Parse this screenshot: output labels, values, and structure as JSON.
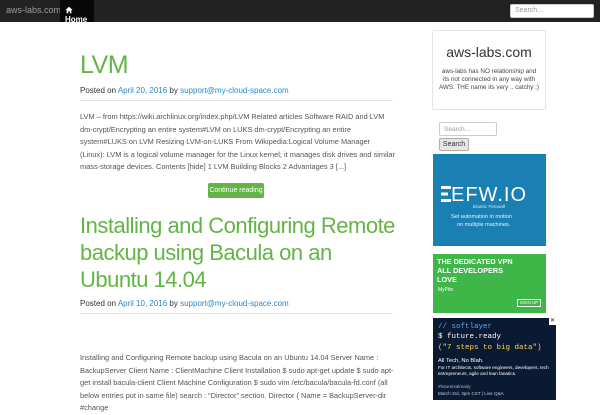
{
  "header": {
    "brand": "aws-labs.com",
    "nav_home": "Home",
    "search_placeholder": "Search..."
  },
  "posts": [
    {
      "title": "LVM",
      "posted_on_label": "Posted on",
      "date": "April 20, 2016",
      "by_label": "by",
      "author": "support@my-cloud-space.com",
      "excerpt": "LVM –  from https://wiki.archlinux.org/index.php/LVM Related articles Software RAID and LVM dm-crypt/Encrypting an entire system#LVM on LUKS dm-crypt/Encrypting an entire system#LUKS on LVM Resizing LVM-on-LUKS From Wikipedia:Logical Volume Manager (Linux): LVM is a logical volume manager for the Linux kernel; it manages disk drives and similar mass-storage devices. Contents  [hide]  1 LVM Building Blocks 2 Advantages 3 [...]",
      "continue_label": "Continue reading"
    },
    {
      "title": "Installing and Configuring Remote backup using Bacula on an Ubuntu 14.04",
      "posted_on_label": "Posted on",
      "date": "April 10, 2016",
      "by_label": "by",
      "author": "support@my-cloud-space.com",
      "excerpt": "Installing and Configuring Remote backup using Bacula on an Ubuntu 14.04 Server Name : BackupServer Client Name : ClientMachine Client Installation $ sudo apt-get update $ sudo apt-get install bacula-client Client Machine Configuration $ sudo vim /etc/bacula/bacula-fd.conf (all below entries put in same file) search : “Director” section. Director { Name = BackupServer-dir #change"
    }
  ],
  "sidebar": {
    "about_title": "aws-labs.com",
    "about_text": "aws-labs has NO relationship and its not connected in any way with AWS. THE name its very .. catchy ;)",
    "search_placeholder": "Search...",
    "search_button": "Search",
    "ad_efw": {
      "title": "EFW.IO",
      "sub": "Elastic Firewall",
      "line1": "Set automation in motion",
      "line2": "on multiple machines."
    },
    "ad_vpn": {
      "line1": "THE DEDICATED VPN",
      "line2": "ALL DEVELOPERS",
      "line3": "LOVE",
      "brand": "MyPito",
      "button": "SIGN UP"
    },
    "ad_softlayer": {
      "line1": "// softlayer",
      "line2": "$ future.ready",
      "line3": "(\"7 steps to big data\")",
      "line4": "All Tech, No Blah.",
      "line5": "For IT architects, software engineers, developers, tech entrepreneurs, agile and lean fanatics.",
      "line6": "#futureisalready",
      "line7": "March 3rd, 3pm CST | Live Q&A"
    }
  },
  "colors": {
    "topbar": "#222222",
    "accent_green": "#62b545",
    "link_blue": "#2a88c8"
  }
}
